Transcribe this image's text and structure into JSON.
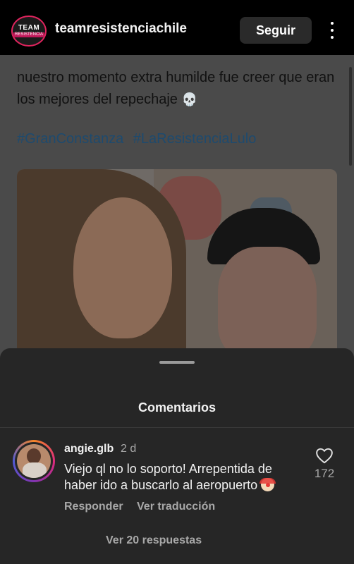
{
  "header": {
    "account_name": "teamresistenciachile",
    "avatar_text_top": "TEAM",
    "avatar_text_bottom": "RESISTENCIA",
    "follow_label": "Seguir"
  },
  "post": {
    "caption": "nuestro momento extra humilde fue creer que eran los mejores del repechaje",
    "caption_emoji": "💀",
    "hashtags": [
      "#GranConstanza",
      "#LaResistenciaLulo"
    ]
  },
  "comments_sheet": {
    "title": "Comentarios",
    "comment": {
      "username": "angie.glb",
      "time": "2 d",
      "text": "Viejo ql no lo soporto! Arrepentida de haber ido a buscarlo al aeropuerto",
      "like_count": "172",
      "reply_label": "Responder",
      "translate_label": "Ver traducción",
      "view_replies_label": "Ver 20 respuestas"
    }
  },
  "colors": {
    "background": "#000000",
    "sheet": "#262626",
    "hashtag": "#1e4a6e",
    "muted_text": "#a8a8a8"
  }
}
